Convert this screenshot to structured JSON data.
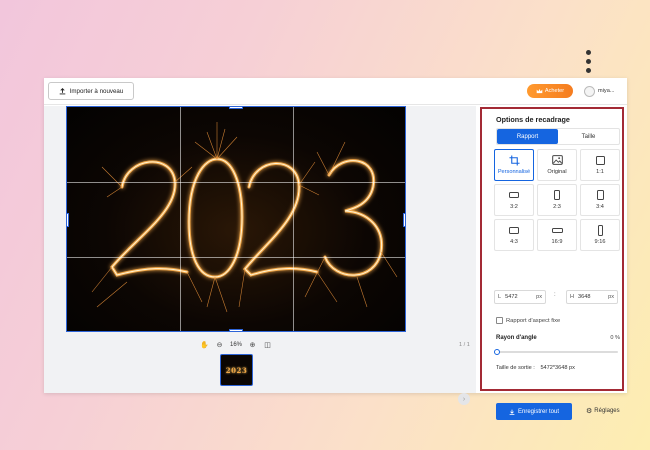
{
  "topbar": {
    "import_label": "Importer à nouveau",
    "buy_label": "Acheter",
    "user_label": "miya..."
  },
  "canvas": {
    "zoom": "16%",
    "page_count": "1 / 1",
    "thumb_text": "2023"
  },
  "panel": {
    "title": "Options de recadrage",
    "tabs": [
      {
        "label": "Rapport",
        "active": true
      },
      {
        "label": "Taille",
        "active": false
      }
    ],
    "ratios": [
      {
        "label": "Personnalisé",
        "icon": "crop-icon",
        "active": true
      },
      {
        "label": "Original",
        "icon": "image-icon",
        "active": false
      },
      {
        "label": "1:1",
        "icon": "square-icon",
        "active": false
      },
      {
        "label": "3:2",
        "icon": "landscape-icon",
        "active": false
      },
      {
        "label": "2:3",
        "icon": "portrait-icon",
        "active": false
      },
      {
        "label": "3:4",
        "icon": "portrait-icon",
        "active": false
      },
      {
        "label": "4:3",
        "icon": "landscape-icon",
        "active": false
      },
      {
        "label": "16:9",
        "icon": "wide-icon",
        "active": false
      },
      {
        "label": "9:16",
        "icon": "tall-icon",
        "active": false
      }
    ],
    "width_prefix": "L",
    "width_value": "5472",
    "height_prefix": "H",
    "height_value": "3648",
    "unit": "px",
    "fixed_ratio_label": "Rapport d'aspect fixe",
    "fixed_ratio_checked": false,
    "corner_label": "Rayon d'angle",
    "corner_value": "0 %",
    "corner_level": 0,
    "output_label": "Taille de sortie :",
    "output_value": "5472*3648 px",
    "save_all_label": "Enregistrer tout",
    "settings_label": "Réglages"
  },
  "colors": {
    "accent": "#1565e0",
    "highlight_border": "#a32a35",
    "buy": "#f57c1f"
  }
}
